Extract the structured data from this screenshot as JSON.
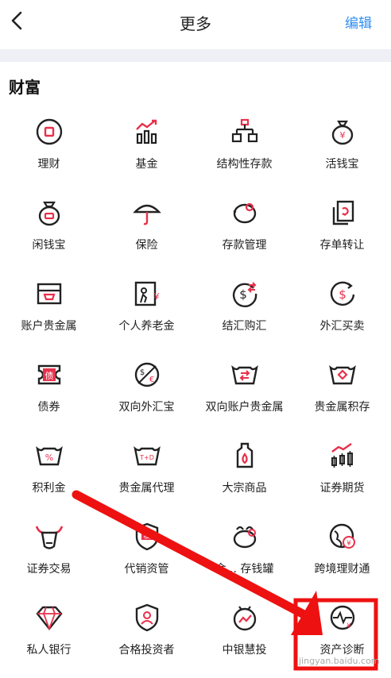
{
  "header": {
    "title": "更多",
    "edit": "编辑"
  },
  "section": {
    "title": "财富"
  },
  "items": [
    {
      "label": "理财",
      "icon": "square-coin-icon"
    },
    {
      "label": "基金",
      "icon": "bar-trend-icon"
    },
    {
      "label": "结构性存款",
      "icon": "hierarchy-icon"
    },
    {
      "label": "活钱宝",
      "icon": "yen-bag-icon"
    },
    {
      "label": "闲钱宝",
      "icon": "money-bag-icon"
    },
    {
      "label": "保险",
      "icon": "umbrella-icon"
    },
    {
      "label": "存款管理",
      "icon": "piggy-bank-icon"
    },
    {
      "label": "存单转让",
      "icon": "certificate-transfer-icon"
    },
    {
      "label": "账户贵金属",
      "icon": "gold-box-icon"
    },
    {
      "label": "个人养老金",
      "icon": "pension-icon"
    },
    {
      "label": "结汇购汇",
      "icon": "dollar-exchange-icon"
    },
    {
      "label": "外汇买卖",
      "icon": "dollar-cycle-icon"
    },
    {
      "label": "债券",
      "icon": "bond-icon"
    },
    {
      "label": "双向外汇宝",
      "icon": "dollar-euro-icon"
    },
    {
      "label": "双向账户贵金属",
      "icon": "ingot-exchange-icon"
    },
    {
      "label": "贵金属积存",
      "icon": "ingot-diamond-icon"
    },
    {
      "label": "积利金",
      "icon": "ingot-percent-icon"
    },
    {
      "label": "贵金属代理",
      "icon": "ingot-td-icon"
    },
    {
      "label": "大宗商品",
      "icon": "oil-bottle-icon"
    },
    {
      "label": "证券期货",
      "icon": "candlestick-icon"
    },
    {
      "label": "证券交易",
      "icon": "bull-icon"
    },
    {
      "label": "代销资管",
      "icon": "private-shield-icon"
    },
    {
      "label": "金... 存钱罐",
      "icon": "piggy-icon"
    },
    {
      "label": "跨境理财通",
      "icon": "globe-yen-icon"
    },
    {
      "label": "私人银行",
      "icon": "diamond-icon"
    },
    {
      "label": "合格投资者",
      "icon": "investor-shield-icon"
    },
    {
      "label": "中银慧投",
      "icon": "smart-invest-icon"
    },
    {
      "label": "资产诊断",
      "icon": "asset-diagnosis-icon"
    }
  ],
  "colors": {
    "accent": "#e8304a",
    "highlight": "#ee1111",
    "edit": "#2f8ef4"
  },
  "watermark": "jingyan.baidu.com"
}
